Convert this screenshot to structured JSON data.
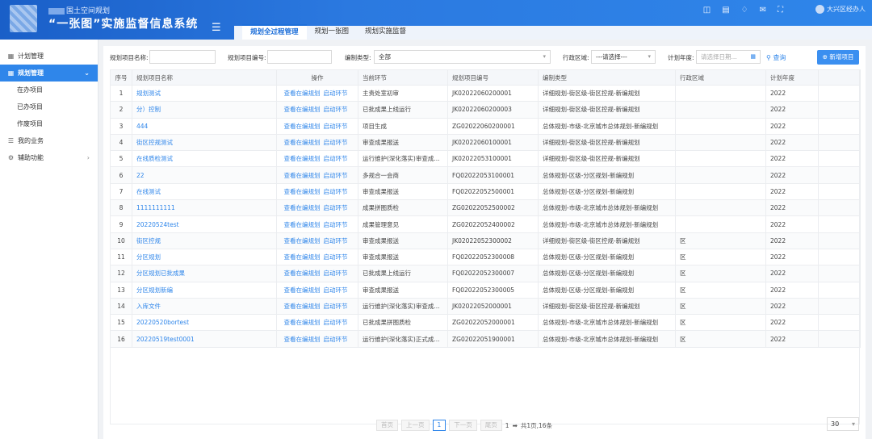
{
  "header": {
    "org": "国土空间规划",
    "title": "“一张图”实施监督信息系统",
    "user": "大兴区经办人"
  },
  "tabs": [
    {
      "label": "规划全过程管理",
      "active": true
    },
    {
      "label": "规划一张图",
      "active": false
    },
    {
      "label": "规划实施监督",
      "active": false
    }
  ],
  "sidebar": {
    "items": [
      {
        "label": "计划管理",
        "icon": "doc-icon"
      },
      {
        "label": "规划管理",
        "icon": "grid-icon",
        "active": true
      },
      {
        "label": "在办项目",
        "sub": true
      },
      {
        "label": "已办项目",
        "sub": true
      },
      {
        "label": "作废项目",
        "sub": true
      },
      {
        "label": "我的业务",
        "icon": "list-icon"
      },
      {
        "label": "辅助功能",
        "icon": "tool-icon"
      }
    ]
  },
  "filters": {
    "name_label": "规划项目名称:",
    "code_label": "规划项目编号:",
    "type_label": "编制类型:",
    "type_value": "全部",
    "region_label": "行政区域:",
    "region_value": "---请选择---",
    "year_label": "计划年度:",
    "year_placeholder": "请选择日期...",
    "search": "查询",
    "new": "新增项目"
  },
  "table": {
    "headers": [
      "序号",
      "规划项目名称",
      "操作",
      "当前环节",
      "规划项目编号",
      "编制类型",
      "行政区域",
      "计划年度"
    ],
    "op_view": "查看在编规划",
    "op_start": "启动环节",
    "rows": [
      {
        "no": "1",
        "name": "规划测试",
        "step": "主责处室初审",
        "code": "JK02022060200001",
        "type": "详细规划-街区级-街区控规-新编规划",
        "region": "",
        "year": "2022"
      },
      {
        "no": "2",
        "name": "分）控制",
        "step": "已批成果上线运行",
        "code": "JK02022060200003",
        "type": "详细规划-街区级-街区控规-新编规划",
        "region": "",
        "year": "2022"
      },
      {
        "no": "3",
        "name": "444",
        "step": "项目生成",
        "code": "ZG02022060200001",
        "type": "总体规划-市级-北京城市总体规划-新编规划",
        "region": "",
        "year": "2022"
      },
      {
        "no": "4",
        "name": "街区控规测试",
        "step": "审查成果报送",
        "code": "JK02022060100001",
        "type": "详细规划-街区级-街区控规-新编规划",
        "region": "",
        "year": "2022"
      },
      {
        "no": "5",
        "name": "在线质检测试",
        "step": "运行维护(深化落实)审查成...",
        "code": "JK02022053100001",
        "type": "详细规划-街区级-街区控规-新编规划",
        "region": "",
        "year": "2022"
      },
      {
        "no": "6",
        "name": "22",
        "step": "多规合一会商",
        "code": "FQ02022053100001",
        "type": "总体规划-区级-分区规划-新编规划",
        "region": "",
        "year": "2022"
      },
      {
        "no": "7",
        "name": "在线测试",
        "step": "审查成果报送",
        "code": "FQ02022052500001",
        "type": "总体规划-区级-分区规划-新编规划",
        "region": "",
        "year": "2022"
      },
      {
        "no": "8",
        "name": "1111111111",
        "step": "成果拼图质检",
        "code": "ZG02022052500002",
        "type": "总体规划-市级-北京城市总体规划-新编规划",
        "region": "",
        "year": "2022"
      },
      {
        "no": "9",
        "name": "20220524test",
        "step": "成果管理意见",
        "code": "ZG02022052400002",
        "type": "总体规划-市级-北京城市总体规划-新编规划",
        "region": "",
        "year": "2022"
      },
      {
        "no": "10",
        "name": "街区控规",
        "step": "审查成果报送",
        "code": "JK02022052300002",
        "type": "详细规划-街区级-街区控规-新编规划",
        "region": "区",
        "year": "2022"
      },
      {
        "no": "11",
        "name": "分区规划",
        "step": "审查成果报送",
        "code": "FQ02022052300008",
        "type": "总体规划-区级-分区规划-新编规划",
        "region": "区",
        "year": "2022"
      },
      {
        "no": "12",
        "name": "分区规划已批成果",
        "step": "已批成果上线运行",
        "code": "FQ02022052300007",
        "type": "总体规划-区级-分区规划-新编规划",
        "region": "区",
        "year": "2022"
      },
      {
        "no": "13",
        "name": "分区规划新编",
        "step": "审查成果报送",
        "code": "FQ02022052300005",
        "type": "总体规划-区级-分区规划-新编规划",
        "region": "区",
        "year": "2022"
      },
      {
        "no": "14",
        "name": "入库文件",
        "step": "运行维护(深化落实)审查成...",
        "code": "JK02022052000001",
        "type": "详细规划-街区级-街区控规-新编规划",
        "region": "区",
        "year": "2022"
      },
      {
        "no": "15",
        "name": "20220520bortest",
        "step": "已批成果拼图质检",
        "code": "ZG02022052000001",
        "type": "总体规划-市级-北京城市总体规划-新编规划",
        "region": "区",
        "year": "2022"
      },
      {
        "no": "16",
        "name": "20220519test0001",
        "step": "运行维护(深化落实)正式成...",
        "code": "ZG02022051900001",
        "type": "总体规划-市级-北京城市总体规划-新编规划",
        "region": "区",
        "year": "2022"
      }
    ]
  },
  "pager": {
    "first": "首页",
    "prev": "上一页",
    "current": "1",
    "next": "下一页",
    "last": "尾页",
    "page_input": "1",
    "summary": "共1页,16条",
    "page_size": "30"
  }
}
